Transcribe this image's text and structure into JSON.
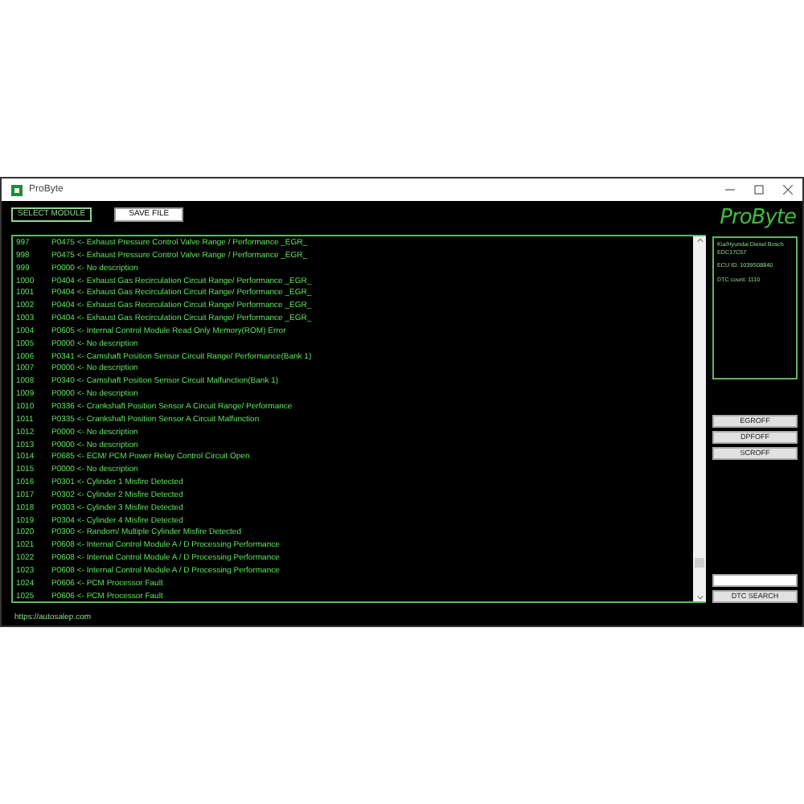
{
  "window": {
    "title": "ProByte"
  },
  "toolbar": {
    "buttons": [
      "SELECT MODULE",
      "SAVE FILE"
    ]
  },
  "logo": "ProByte",
  "dtc_list": [
    {
      "index": "997",
      "text": "P0475 <- Exhaust Pressure Control Valve Range / Performance _EGR_"
    },
    {
      "index": "998",
      "text": "P0475 <- Exhaust Pressure Control Valve Range / Performance _EGR_"
    },
    {
      "index": "999",
      "text": "P0000 <- No description"
    },
    {
      "index": "1000",
      "text": "P0404 <- Exhaust Gas Recirculation Circuit Range/ Performance _EGR_"
    },
    {
      "index": "1001",
      "text": "P0404 <- Exhaust Gas Recirculation Circuit Range/ Performance _EGR_"
    },
    {
      "index": "1002",
      "text": "P0404 <- Exhaust Gas Recirculation Circuit Range/ Performance _EGR_"
    },
    {
      "index": "1003",
      "text": "P0404 <- Exhaust Gas Recirculation Circuit Range/ Performance _EGR_"
    },
    {
      "index": "1004",
      "text": "P0605 <- Internal Control Module Read Only Memory(ROM) Error"
    },
    {
      "index": "1005",
      "text": "P0000 <- No description"
    },
    {
      "index": "1006",
      "text": "P0341 <- Camshaft Position Sensor Circuit Range/ Performance(Bank 1)"
    },
    {
      "index": "1007",
      "text": "P0000 <- No description"
    },
    {
      "index": "1008",
      "text": "P0340 <- Camshaft Position Sensor Circuit Malfunction(Bank 1)"
    },
    {
      "index": "1009",
      "text": "P0000 <- No description"
    },
    {
      "index": "1010",
      "text": "P0336 <- Crankshaft Position Sensor A Circuit Range/ Performance"
    },
    {
      "index": "1011",
      "text": "P0335 <- Crankshaft Position Sensor A Circuit Malfunction"
    },
    {
      "index": "1012",
      "text": "P0000 <- No description"
    },
    {
      "index": "1013",
      "text": "P0000 <- No description"
    },
    {
      "index": "1014",
      "text": "P0685 <- ECM/ PCM Power Relay Control Circuit Open"
    },
    {
      "index": "1015",
      "text": "P0000 <- No description"
    },
    {
      "index": "1016",
      "text": "P0301 <- Cylinder 1 Misfire Detected"
    },
    {
      "index": "1017",
      "text": "P0302 <- Cylinder 2 Misfire Detected"
    },
    {
      "index": "1018",
      "text": "P0303 <- Cylinder 3 Misfire Detected"
    },
    {
      "index": "1019",
      "text": "P0304 <- Cylinder 4 Misfire Detected"
    },
    {
      "index": "1020",
      "text": "P0300 <- Random/ Multiple Cylinder Misfire Detected"
    },
    {
      "index": "1021",
      "text": "P0608 <- Internal Control Module A / D Processing Performance"
    },
    {
      "index": "1022",
      "text": "P0608 <- Internal Control Module A / D Processing Performance"
    },
    {
      "index": "1023",
      "text": "P0608 <- Internal Control Module A / D Processing Performance"
    },
    {
      "index": "1024",
      "text": "P0606 <- PCM Processor Fault"
    },
    {
      "index": "1025",
      "text": "P0606 <- PCM Processor Fault"
    }
  ],
  "info_panel": [
    "Kia/Hyundai Diesel Bosch EDC17C57",
    "ECU ID: 1039S08840",
    "DTC count: 1110"
  ],
  "action_buttons": [
    "EGROFF",
    "DPFOFF",
    "SCROFF"
  ],
  "search": {
    "button": "DTC SEARCH"
  },
  "status_bar": "https://autosalep.com"
}
